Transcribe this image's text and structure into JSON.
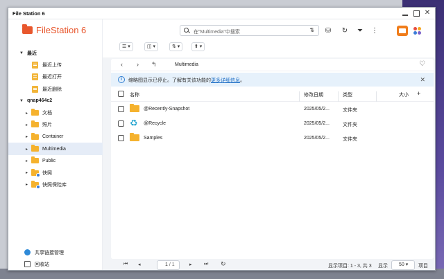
{
  "window": {
    "title": "File Station 6"
  },
  "app": {
    "logo_text": "FileStation 6"
  },
  "sidebar": {
    "recent_group": "最近",
    "recent_items": [
      "最近上传",
      "最近打开",
      "最近删除"
    ],
    "nas_group": "qnap464c2",
    "folders": [
      "文档",
      "照片",
      "Container",
      "Multimedia",
      "Public",
      "快照",
      "快照保险库"
    ],
    "selected_folder": "Multimedia",
    "bottom": {
      "share_label": "共享链接管理",
      "recycle_label": "回收站"
    }
  },
  "toolbar": {
    "search_placeholder": "在\"Multimedia\"中搜索",
    "sort_icon": "sort-icon",
    "accent_color": "#f07d1b"
  },
  "path": {
    "current": "Multimedia"
  },
  "notice": {
    "message": "缩略图显示已停止。了解有关该功能的",
    "link": "更多详细信息",
    "suffix": "。"
  },
  "table": {
    "columns": {
      "name": "名称",
      "modified": "修改日期",
      "type": "类型",
      "size": "大小"
    },
    "rows": [
      {
        "name": "@Recently-Snapshot",
        "modified": "2025/05/2...",
        "type": "文件夹",
        "icon": "folder-icon"
      },
      {
        "name": "@Recycle",
        "modified": "2025/05/2...",
        "type": "文件夹",
        "icon": "recycle-icon"
      },
      {
        "name": "Samples",
        "modified": "2025/05/2...",
        "type": "文件夹",
        "icon": "folder-icon"
      }
    ]
  },
  "pager": {
    "page_value": "1",
    "page_total": "/ 1",
    "info": "显示项目: 1 - 3, 共 3",
    "show_label": "显示",
    "per_page": "50",
    "items_label": "项目"
  }
}
